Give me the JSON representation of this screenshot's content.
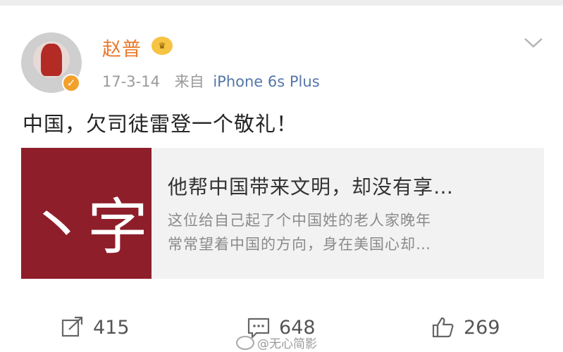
{
  "user": {
    "name": "赵普",
    "vip_icon": "vip-crown-icon",
    "verified_icon": "verified-v-icon"
  },
  "meta": {
    "date": "17-3-14",
    "source_prefix": "来自",
    "source": "iPhone 6s Plus"
  },
  "post": {
    "text": "中国，欠司徒雷登一个敬礼！"
  },
  "link_card": {
    "thumb_text": "丶字",
    "title": "他帮中国带来文明，却没有享…",
    "desc_line1": "这位给自己起了个中国姓的老人家晚年",
    "desc_line2": "常常望着中国的方向，身在美国心却…"
  },
  "actions": {
    "repost_count": "415",
    "comment_count": "648",
    "like_count": "269"
  },
  "watermark": {
    "text": "@无心简影"
  },
  "colors": {
    "username": "#eb7a2c",
    "source": "#5576a8",
    "thumb_bg": "#8e1e2a",
    "badge": "#f3a12b"
  }
}
